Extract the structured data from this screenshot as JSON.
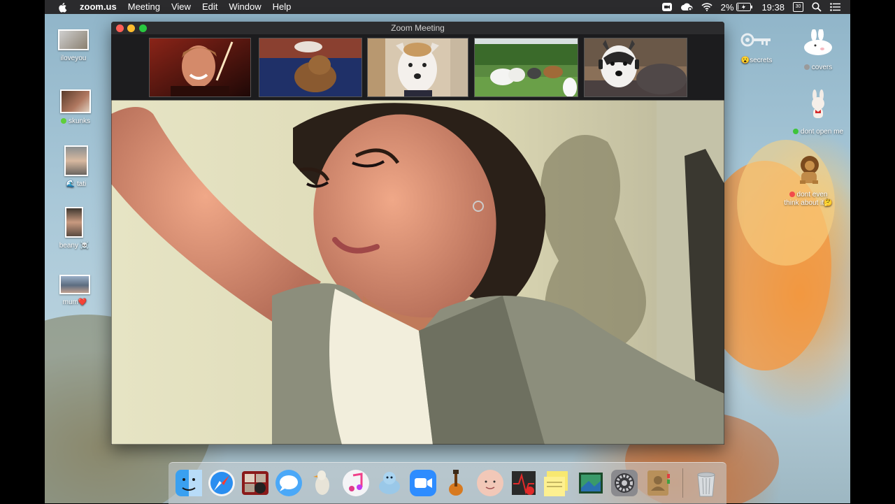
{
  "menubar": {
    "app_name": "zoom.us",
    "menus": [
      "Meeting",
      "View",
      "Edit",
      "Window",
      "Help"
    ],
    "battery": "2%",
    "time": "19:38",
    "calendar_day": "30"
  },
  "desktop": {
    "left_items": [
      {
        "label": "iloveyou",
        "dot_color": ""
      },
      {
        "label": "skunks",
        "dot_color": "#5fcf3a"
      },
      {
        "label": "tati",
        "prefix_emoji": "🌊"
      },
      {
        "label": "beany",
        "suffix_emoji": "☠️"
      },
      {
        "label": "mum",
        "suffix_emoji": "❤️"
      }
    ],
    "right_items": [
      {
        "label": "secrets",
        "prefix_emoji": "😮"
      },
      {
        "label": "covers",
        "dot_color": "#9a9a9a"
      },
      {
        "label": "dont open me",
        "dot_color": "#3ec43a"
      },
      {
        "label_line1": "dont even",
        "label_line2": "think about it",
        "dot_color": "#f24b4b",
        "suffix_emoji": "🤔"
      }
    ]
  },
  "zoom_window": {
    "title": "Zoom Meeting",
    "participants": [
      "man-smiling",
      "dog-on-couch",
      "white-dog",
      "dogs-in-garden",
      "husky"
    ]
  },
  "dock": {
    "apps": [
      "finder-icon",
      "safari-icon",
      "photo-booth-icon",
      "messages-icon",
      "cyberduck-icon",
      "itunes-icon",
      "sequel-pro-icon",
      "zoom-icon",
      "garageband-icon",
      "avatar-app-icon",
      "scrobbles-icon",
      "stickies-icon",
      "preview-icon",
      "system-preferences-icon",
      "contacts-icon",
      "trash-icon"
    ]
  },
  "colors": {
    "menubar_bg": "#2b2b2d",
    "close": "#ff5f57",
    "minimize": "#febc2e",
    "zoom": "#28c840",
    "zoom_blue": "#2d8cff"
  }
}
